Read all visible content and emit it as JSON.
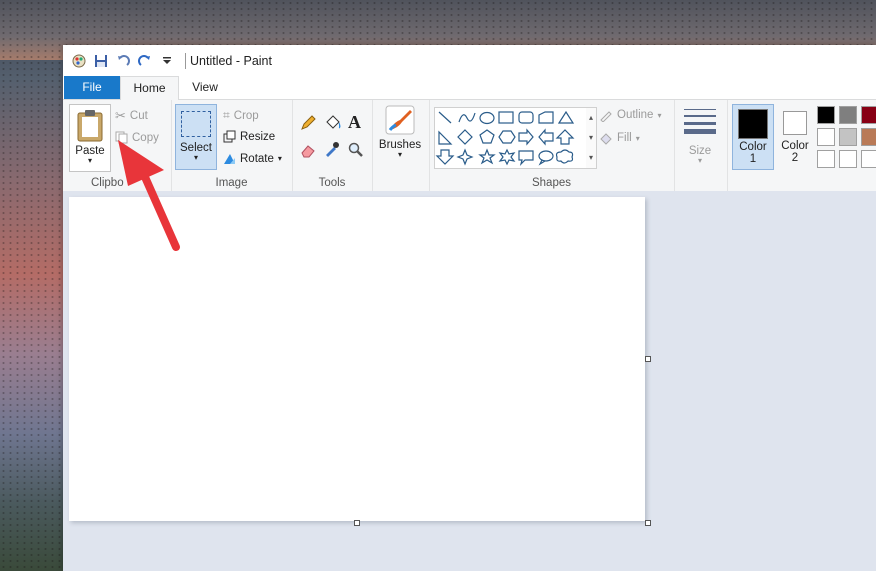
{
  "window": {
    "title": "Untitled - Paint"
  },
  "tabs": {
    "file": "File",
    "home": "Home",
    "view": "View"
  },
  "clipboard": {
    "paste": "Paste",
    "cut": "Cut",
    "copy": "Copy",
    "group_label": "Clipbo"
  },
  "image": {
    "select": "Select",
    "crop": "Crop",
    "resize": "Resize",
    "rotate": "Rotate",
    "group_label": "Image"
  },
  "tools": {
    "group_label": "Tools"
  },
  "brushes": {
    "label": "Brushes"
  },
  "shapes": {
    "outline": "Outline",
    "fill": "Fill",
    "group_label": "Shapes"
  },
  "size": {
    "label": "Size"
  },
  "colors": {
    "color1_label": "Color",
    "color1_num": "1",
    "color2_label": "Color",
    "color2_num": "2",
    "color1": "#000000",
    "color2": "#ffffff",
    "palette": [
      "#000000",
      "#7f7f7f",
      "#880015",
      "#ffffff",
      "#c3c3c3",
      "#b97a57",
      "#ffffff",
      "#ffffff",
      "#ffffff"
    ]
  },
  "annotation": {
    "arrow_color": "#e8353a"
  }
}
